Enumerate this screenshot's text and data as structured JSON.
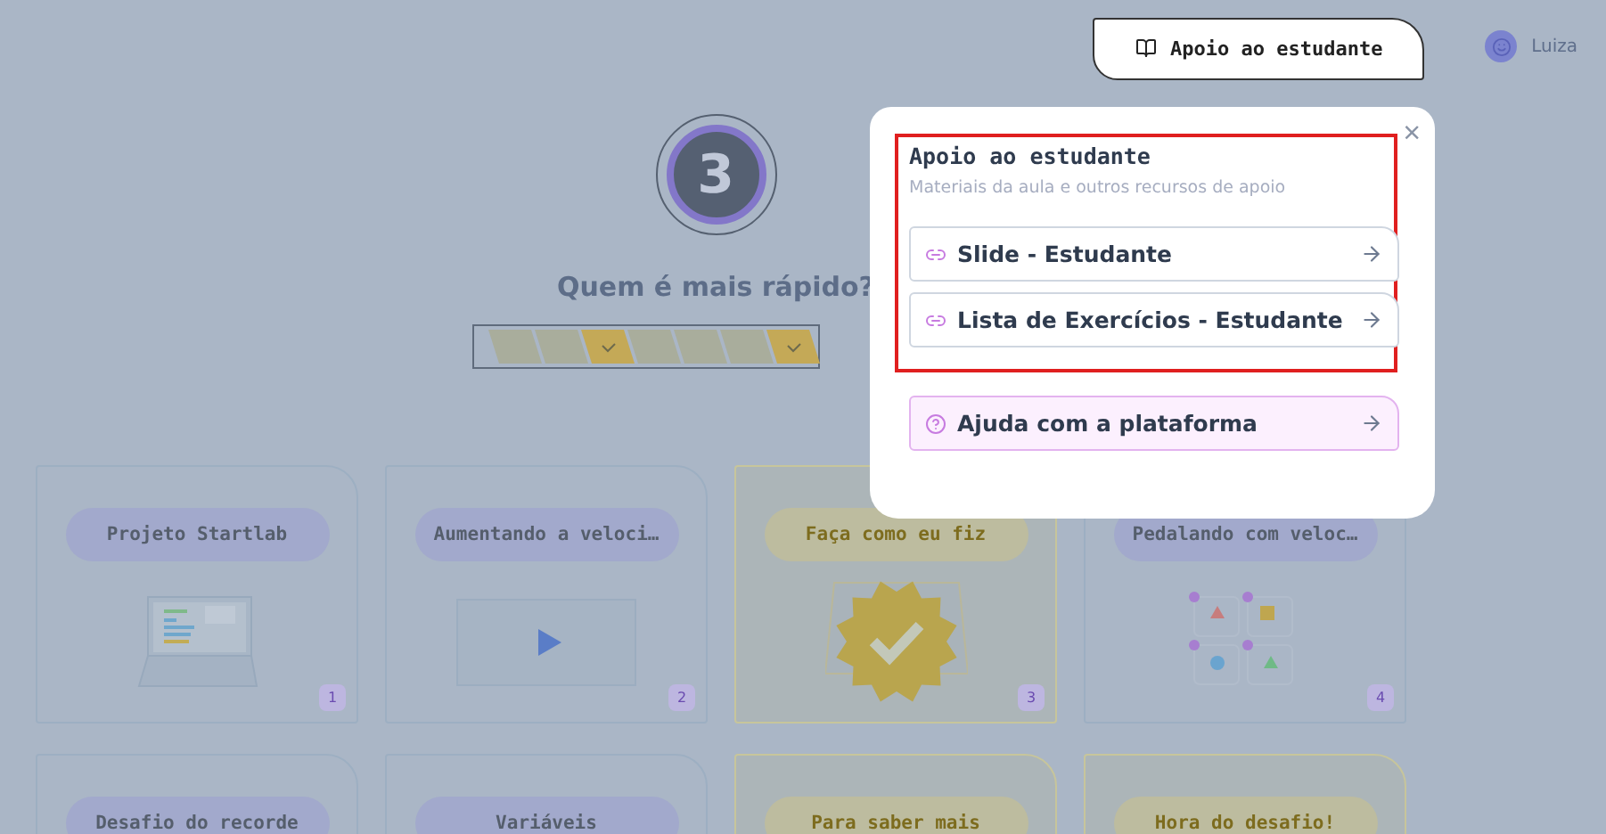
{
  "header": {
    "support_button": "Apoio ao estudante",
    "user_name": "Luiza"
  },
  "lesson": {
    "number": "3",
    "title": "Quem é mais rápido?"
  },
  "progress": [
    {
      "done": false
    },
    {
      "done": false
    },
    {
      "done": true
    },
    {
      "done": false
    },
    {
      "done": false
    },
    {
      "done": false
    },
    {
      "done": true
    }
  ],
  "cards": [
    {
      "title": "Projeto Startlab",
      "kind": "lesson",
      "number": "1"
    },
    {
      "title": "Aumentando a veloci…",
      "kind": "lesson",
      "number": "2"
    },
    {
      "title": "Faça como eu fiz",
      "kind": "activity",
      "number": "3"
    },
    {
      "title": "Pedalando com veloc…",
      "kind": "lesson",
      "number": "4"
    },
    {
      "title": "Desafio do recorde",
      "kind": "lesson"
    },
    {
      "title": "Variáveis",
      "kind": "lesson"
    },
    {
      "title": "Para saber mais",
      "kind": "activity"
    },
    {
      "title": "Hora do desafio!",
      "kind": "activity"
    }
  ],
  "popup": {
    "title": "Apoio ao estudante",
    "close": "×",
    "subtitle": "Materiais da aula e outros recursos de apoio",
    "links": [
      {
        "label": "Slide - Estudante",
        "kind": "material"
      },
      {
        "label": "Lista de Exercícios - Estudante",
        "kind": "material"
      },
      {
        "label": "Ajuda com a plataforma",
        "kind": "help"
      }
    ]
  }
}
